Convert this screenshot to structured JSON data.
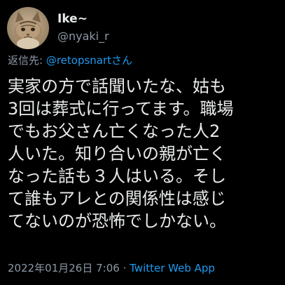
{
  "user": {
    "display_name": "Ike~",
    "handle": "@nyaki_r",
    "avatar_icon": "cat-avatar-icon"
  },
  "reply": {
    "prefix": "返信先: ",
    "mention": "@retopsnartさん"
  },
  "tweet": {
    "lines": [
      "実家の方で話聞いたな、姑も",
      "3回は葬式に行ってます。職場",
      "でもお父さん亡くなった人2",
      "人いた。知り合いの親が亡く",
      "なった話も３人はいる。そし",
      "て誰もアレとの関係性は感じ",
      "てないのが恐怖でしかない。"
    ]
  },
  "meta": {
    "timestamp": "2022年01月26日 7:06",
    "separator": " · ",
    "source": "Twitter Web App"
  },
  "colors": {
    "background": "#000000",
    "text": "#e7e9ea",
    "secondary": "#8b98a5",
    "link": "#1d9bf0"
  }
}
